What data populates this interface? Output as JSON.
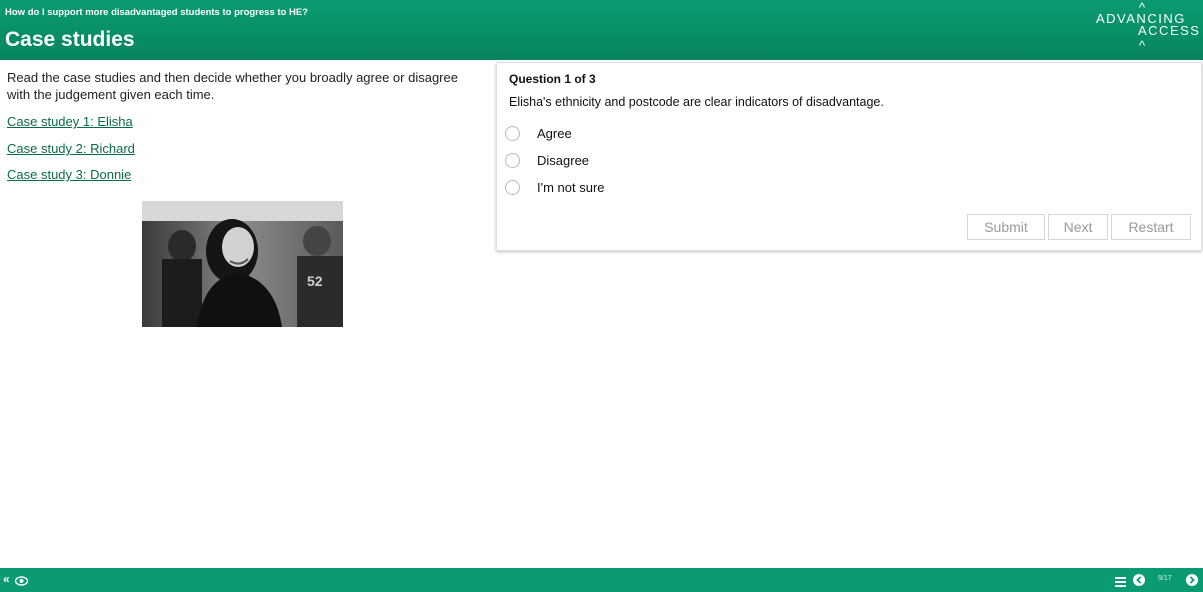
{
  "header": {
    "subtitle": "How do I support more disadvantaged students to progress to HE?",
    "title": "Case studies",
    "logo_line1": "ADVANCING",
    "logo_line2": "ACCESS"
  },
  "left": {
    "intro": "Read the case studies and then decide whether you broadly agree or disagree with the judgement given each time.",
    "links": [
      {
        "label": "Case studey 1: Elisha"
      },
      {
        "label": "Case study 2: Richard"
      },
      {
        "label": "Case study 3: Donnie"
      }
    ]
  },
  "question": {
    "number": "Question 1 of 3",
    "text": "Elisha's ethnicity and postcode are clear indicators of disadvantage.",
    "options": [
      {
        "label": "Agree"
      },
      {
        "label": "Disagree"
      },
      {
        "label": "I'm not sure"
      }
    ],
    "buttons": {
      "submit": "Submit",
      "next": "Next",
      "restart": "Restart"
    }
  },
  "footer": {
    "page_counter": "9/17",
    "icons": [
      "collapse-left-icon",
      "eye-icon",
      "menu-icon",
      "previous-icon",
      "next-icon"
    ]
  },
  "colors": {
    "brand_green": "#0a9b72",
    "link_green": "#0a6b4a",
    "button_text": "#9a9a9a"
  }
}
